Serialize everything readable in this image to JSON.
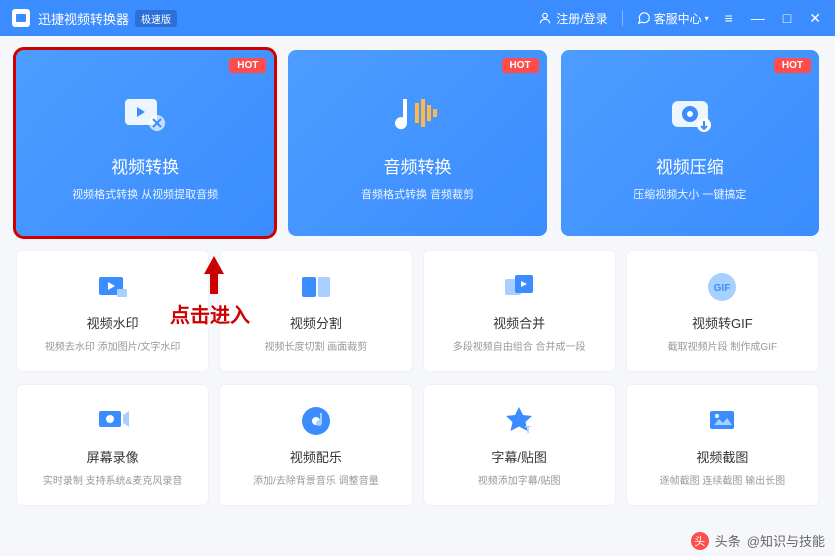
{
  "header": {
    "title": "迅捷视频转换器",
    "badge": "极速版",
    "login": "注册/登录",
    "service": "客服中心"
  },
  "annotation": {
    "text": "点击进入"
  },
  "cards_big": [
    {
      "title": "视频转换",
      "desc": "视频格式转换 从视频提取音频",
      "hot": "HOT"
    },
    {
      "title": "音频转换",
      "desc": "音频格式转换 音频裁剪",
      "hot": "HOT"
    },
    {
      "title": "视频压缩",
      "desc": "压缩视频大小 一键搞定",
      "hot": "HOT"
    }
  ],
  "cards_row2": [
    {
      "title": "视频水印",
      "desc": "视频去水印 添加图片/文字水印"
    },
    {
      "title": "视频分割",
      "desc": "视频长度切割 画面裁剪"
    },
    {
      "title": "视频合并",
      "desc": "多段视频自由组合 合并成一段"
    },
    {
      "title": "视频转GIF",
      "desc": "截取视频片段 制作成GIF"
    }
  ],
  "cards_row3": [
    {
      "title": "屏幕录像",
      "desc": "实时录制 支持系统&麦克风录音"
    },
    {
      "title": "视频配乐",
      "desc": "添加/去除背景音乐 调整音量"
    },
    {
      "title": "字幕/贴图",
      "desc": "视频添加字幕/贴图"
    },
    {
      "title": "视频截图",
      "desc": "逐帧截图 连续截图 输出长图"
    }
  ],
  "watermark": {
    "prefix": "头条",
    "author": "@知识与技能"
  }
}
